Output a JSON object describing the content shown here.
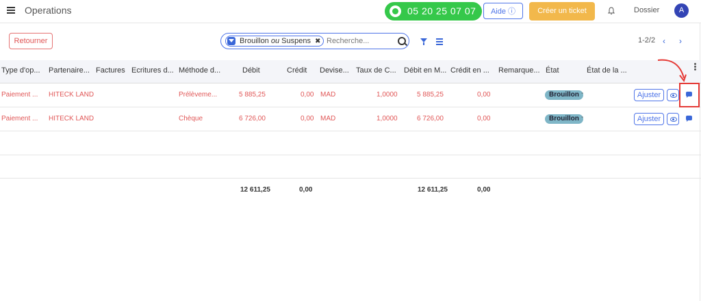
{
  "topbar": {
    "title": "Operations",
    "phone": "05 20 25 07 07",
    "aide": "Aide ⓘ",
    "ticket": "Créer un ticket",
    "dossier": "Dossier",
    "avatar": "A"
  },
  "toolbar": {
    "back": "Retourner",
    "facet_pre": "Brouillon ",
    "facet_ou": "ou",
    "facet_post": " Suspens",
    "facet_x": "✖",
    "search_placeholder": "Recherche...",
    "pager": "1-2/2",
    "prev": "‹",
    "next": "›"
  },
  "columns": [
    "Type d'op...",
    "Partenaire...",
    "Factures",
    "Ecritures d...",
    "Méthode d...",
    "Débit",
    "Crédit",
    "Devise...",
    "Taux de C...",
    "Débit en M...",
    "Crédit en ...",
    "Remarque...",
    "État",
    "État de la ..."
  ],
  "rows": [
    {
      "type": "Paiement ...",
      "partner": "HITECK LAND",
      "method": "Prélèveme...",
      "debit": "5 885,25",
      "credit": "0,00",
      "currency": "MAD",
      "rate": "1,0000",
      "debit_m": "5 885,25",
      "credit_m": "0,00",
      "state": "Brouillon",
      "state2": "-",
      "adjust": "Ajuster"
    },
    {
      "type": "Paiement ...",
      "partner": "HITECK LAND",
      "method": "Chèque",
      "debit": "6 726,00",
      "credit": "0,00",
      "currency": "MAD",
      "rate": "1,0000",
      "debit_m": "6 726,00",
      "credit_m": "0,00",
      "state": "Brouillon",
      "state2": "-",
      "adjust": "Ajuster"
    }
  ],
  "totals": {
    "debit": "12 611,25",
    "credit": "0,00",
    "debit_m": "12 611,25",
    "credit_m": "0,00"
  },
  "colors": {
    "accent": "#4e74e8",
    "green": "#35c84a",
    "orange": "#f2b84b",
    "red": "#e05555",
    "badge": "#7fb6c7",
    "highlight": "#e53935"
  }
}
